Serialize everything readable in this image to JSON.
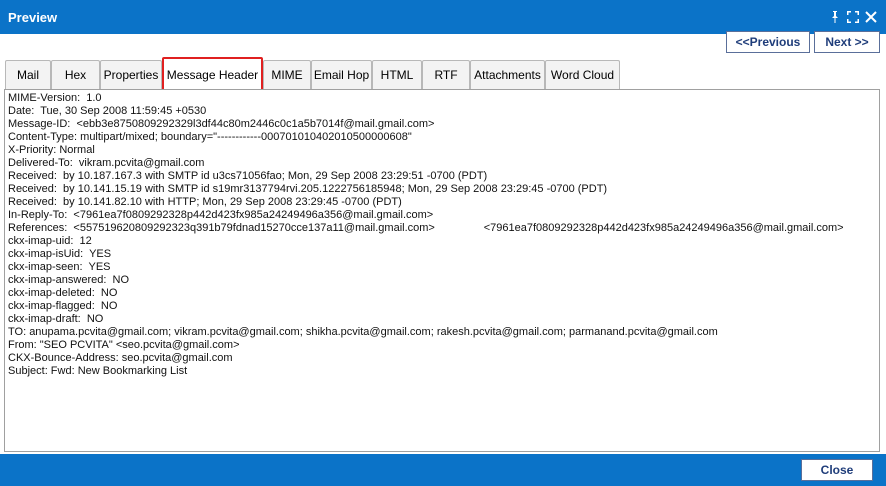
{
  "window": {
    "title": "Preview"
  },
  "nav": {
    "previous_label": "<<Previous",
    "next_label": "Next >>"
  },
  "tabs": [
    {
      "label": "Mail",
      "active": false
    },
    {
      "label": "Hex",
      "active": false
    },
    {
      "label": "Properties",
      "active": false
    },
    {
      "label": "Message Header",
      "active": true
    },
    {
      "label": "MIME",
      "active": false
    },
    {
      "label": "Email Hop",
      "active": false
    },
    {
      "label": "HTML",
      "active": false
    },
    {
      "label": "RTF",
      "active": false
    },
    {
      "label": "Attachments",
      "active": false
    },
    {
      "label": "Word Cloud",
      "active": false
    }
  ],
  "header_lines": [
    "MIME-Version:  1.0",
    "Date:  Tue, 30 Sep 2008 11:59:45 +0530",
    "Message-ID:  <ebb3e8750809292329l3df44c80m2446c0c1a5b7014f@mail.gmail.com>",
    "Content-Type: multipart/mixed; boundary=\"------------000701010402010500000608\"",
    "X-Priority: Normal",
    "Delivered-To:  vikram.pcvita@gmail.com",
    "Received:  by 10.187.167.3 with SMTP id u3cs71056fao; Mon, 29 Sep 2008 23:29:51 -0700 (PDT)",
    "Received:  by 10.141.15.19 with SMTP id s19mr3137794rvi.205.1222756185948; Mon, 29 Sep 2008 23:29:45 -0700 (PDT)",
    "Received:  by 10.141.82.10 with HTTP; Mon, 29 Sep 2008 23:29:45 -0700 (PDT)",
    "In-Reply-To:  <7961ea7f0809292328p442d423fx985a24249496a356@mail.gmail.com>",
    "References:  <557519620809292323q391b79fdnad15270cce137a11@mail.gmail.com>                <7961ea7f0809292328p442d423fx985a24249496a356@mail.gmail.com>",
    "ckx-imap-uid:  12",
    "ckx-imap-isUid:  YES",
    "ckx-imap-seen:  YES",
    "ckx-imap-answered:  NO",
    "ckx-imap-deleted:  NO",
    "ckx-imap-flagged:  NO",
    "ckx-imap-draft:  NO",
    "TO: anupama.pcvita@gmail.com; vikram.pcvita@gmail.com; shikha.pcvita@gmail.com; rakesh.pcvita@gmail.com; parmanand.pcvita@gmail.com",
    "From: \"SEO PCVITA\" <seo.pcvita@gmail.com>",
    "CKX-Bounce-Address: seo.pcvita@gmail.com",
    "Subject: Fwd: New Bookmarking List"
  ],
  "footer": {
    "close_label": "Close"
  },
  "colors": {
    "titlebar": "#0b73c8",
    "active_tab_border": "#e02020",
    "button_text": "#1f3d7a"
  }
}
